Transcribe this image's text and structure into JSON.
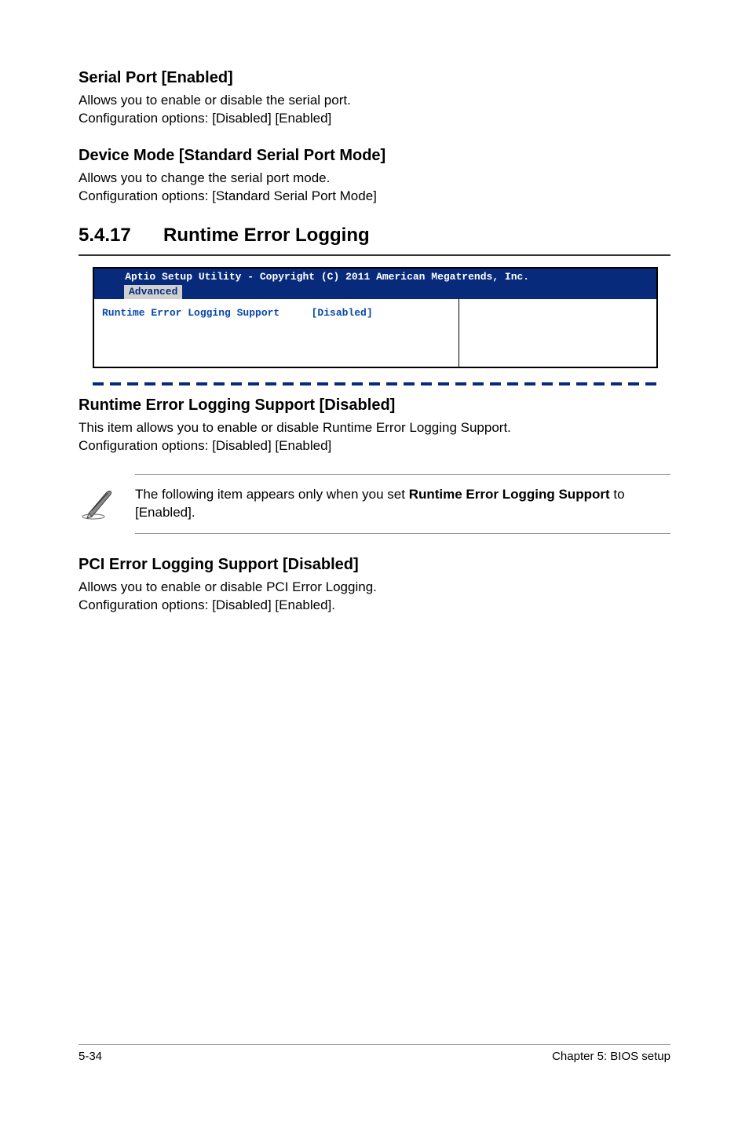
{
  "section1": {
    "heading": "Serial Port [Enabled]",
    "line1": "Allows you to enable or disable the serial port.",
    "line2": "Configuration options: [Disabled] [Enabled]"
  },
  "section2": {
    "heading": "Device Mode [Standard Serial Port Mode]",
    "line1": "Allows you to change the serial port mode.",
    "line2": "Configuration options: [Standard Serial Port Mode]"
  },
  "section3": {
    "num": "5.4.17",
    "title": "Runtime Error Logging"
  },
  "bios": {
    "header": "Aptio Setup Utility - Copyright (C) 2011 American Megatrends, Inc.",
    "tab": "Advanced",
    "item_label": "Runtime Error Logging Support",
    "item_value": "[Disabled]"
  },
  "section4": {
    "heading": "Runtime Error Logging Support [Disabled]",
    "line1": "This item allows you to enable or disable Runtime Error Logging Support.",
    "line2": "Configuration options: [Disabled] [Enabled]"
  },
  "note": {
    "pre": "The following item appears only when you set ",
    "bold": "Runtime Error Logging Support",
    "post": " to [Enabled]."
  },
  "section5": {
    "heading": "PCI Error Logging Support [Disabled]",
    "line1": "Allows you to enable or disable PCI Error Logging.",
    "line2": "Configuration options: [Disabled] [Enabled]."
  },
  "footer": {
    "left": "5-34",
    "right": "Chapter 5: BIOS setup"
  }
}
